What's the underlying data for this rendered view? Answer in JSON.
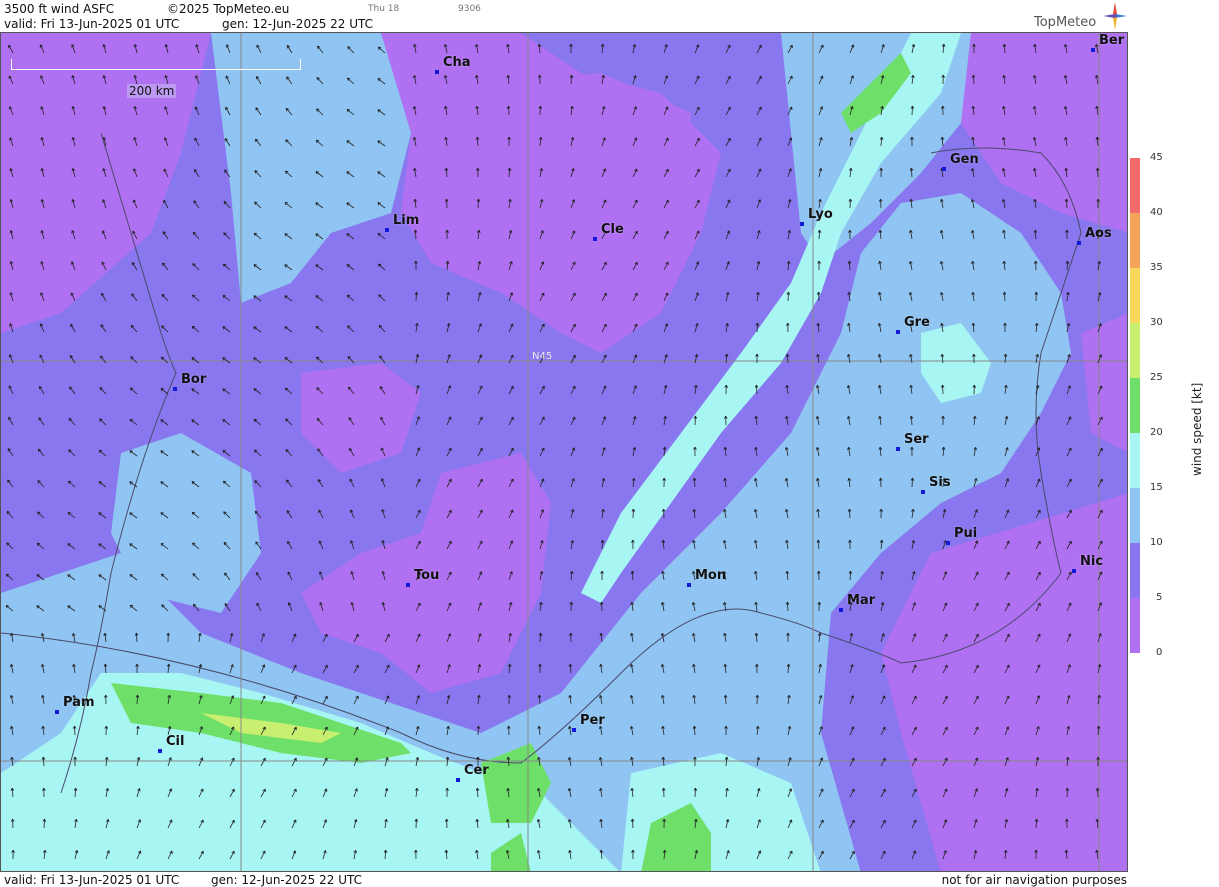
{
  "header": {
    "title": "3500 ft wind ASFC",
    "copyright": "©2025 TopMeteo.eu",
    "day": "Thu 18",
    "code": "9306",
    "valid": "valid:  Fri  13-Jun-2025  01 UTC",
    "gen": "gen: 12-Jun-2025 22 UTC"
  },
  "brand": {
    "logo_text": "TopMeteo"
  },
  "map": {
    "scale_label": "200 km",
    "grid_label": "N45",
    "cities": [
      {
        "name": "Cha"
      },
      {
        "name": "Ber"
      },
      {
        "name": "Gen"
      },
      {
        "name": "Lim"
      },
      {
        "name": "Cle"
      },
      {
        "name": "Lyo"
      },
      {
        "name": "Aos"
      },
      {
        "name": "Gre"
      },
      {
        "name": "Bor"
      },
      {
        "name": "Ser"
      },
      {
        "name": "Sis"
      },
      {
        "name": "Pui"
      },
      {
        "name": "Tou"
      },
      {
        "name": "Mon"
      },
      {
        "name": "Nic"
      },
      {
        "name": "Mar"
      },
      {
        "name": "Pam"
      },
      {
        "name": "Per"
      },
      {
        "name": "Cil"
      },
      {
        "name": "Cer"
      }
    ]
  },
  "legend": {
    "title": "wind  speed  [kt]",
    "ticks": [
      "45",
      "40",
      "35",
      "30",
      "25",
      "20",
      "15",
      "10",
      "5",
      "0"
    ],
    "colors": [
      "#f26a6a",
      "#f6a35a",
      "#f8d85a",
      "#c8ef70",
      "#6ee06a",
      "#a8f6f4",
      "#90c4f2",
      "#8877ee",
      "#b070f2"
    ]
  },
  "footer": {
    "valid": "valid:  Fri  13-Jun-2025  01 UTC",
    "gen": "gen: 12-Jun-2025 22 UTC",
    "note": "not for air navigation purposes"
  }
}
